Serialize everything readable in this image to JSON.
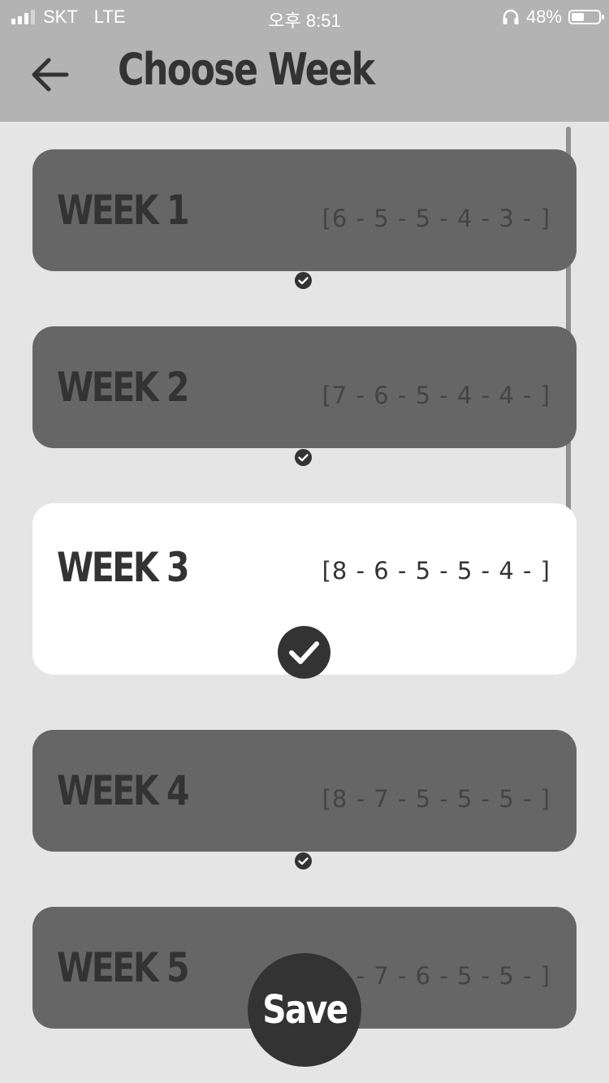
{
  "status_bar": {
    "carrier": "SKT",
    "network": "LTE",
    "time": "오후 8:51",
    "battery": "48%",
    "battery_level": 0.48
  },
  "header": {
    "title": "Choose Week",
    "back_icon": "arrow-left-icon"
  },
  "weeks": [
    {
      "label": "WEEK 1",
      "reps": "[6 - 5 - 5 - 4 - 3 - ]",
      "selected": false
    },
    {
      "label": "WEEK 2",
      "reps": "[7 - 6 - 5 - 4 - 4 - ]",
      "selected": false
    },
    {
      "label": "WEEK 3",
      "reps": "[8 - 6 - 5 - 5 - 4 - ]",
      "selected": true
    },
    {
      "label": "WEEK 4",
      "reps": "[8 - 7 - 5 - 5 - 5 - ]",
      "selected": false
    },
    {
      "label": "WEEK 5",
      "reps": "[9 - 7 - 6 - 5 - 5 - ]",
      "selected": false
    }
  ],
  "save_label": "Save",
  "colors": {
    "header_bg": "#b3b3b3",
    "page_bg": "#e5e5e5",
    "card_inactive": "#666666",
    "card_active": "#ffffff",
    "text_dark": "#333333"
  }
}
